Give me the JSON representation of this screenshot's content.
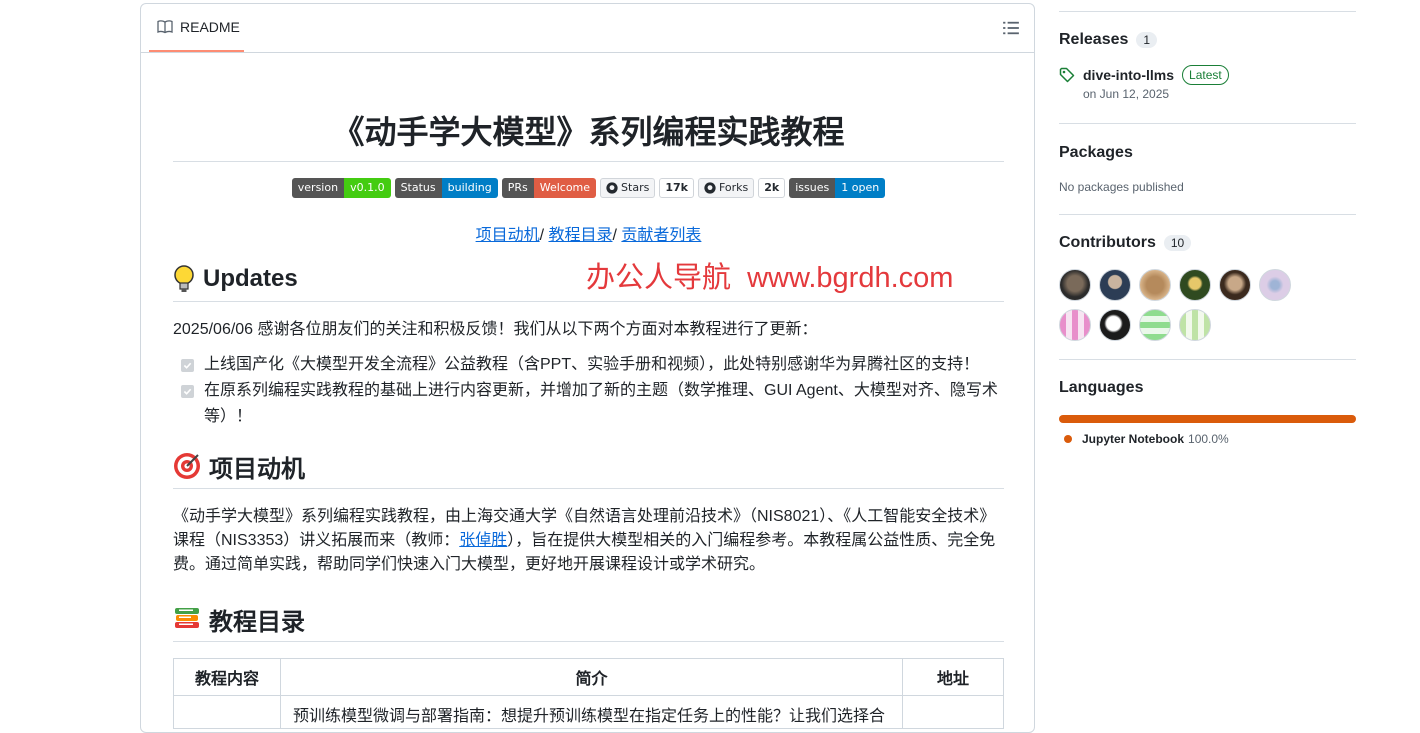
{
  "readme": {
    "tab_label": "README",
    "title": "《动手学大模型》系列编程实践教程",
    "badges": [
      {
        "left": "version",
        "right": "v0.1.0",
        "color": "#4c1"
      },
      {
        "left": "Status",
        "right": "building",
        "color": "#007ec6"
      },
      {
        "left": "PRs",
        "right": "Welcome",
        "color": "#e05d44"
      }
    ],
    "social": [
      {
        "left": "Stars",
        "right": "17k"
      },
      {
        "left": "Forks",
        "right": "2k"
      }
    ],
    "issues_badge": {
      "left": "issues",
      "right": "1 open",
      "color": "#007ec6"
    },
    "nav_links": [
      "项目动机",
      "教程目录",
      "贡献者列表"
    ],
    "nav_sep": "/ ",
    "updates": {
      "heading": "Updates",
      "intro": "2025/06/06 感谢各位朋友们的关注和积极反馈！我们从以下两个方面对本教程进行了更新：",
      "tasks": [
        "上线国产化《大模型开发全流程》公益教程（含PPT、实验手册和视频），此处特别感谢华为昇腾社区的支持！",
        "在原系列编程实践教程的基础上进行内容更新，并增加了新的主题（数学推理、GUI Agent、大模型对齐、隐写术等）！"
      ]
    },
    "motivation": {
      "heading": "项目动机",
      "text_before": "《动手学大模型》系列编程实践教程，由上海交通大学《自然语言处理前沿技术》（NIS8021）、《人工智能安全技术》课程（NIS3353）讲义拓展而来（教师：",
      "teacher_link": "张倬胜",
      "text_after": "），旨在提供大模型相关的入门编程参考。本教程属公益性质、完全免费。通过简单实践，帮助同学们快速入门大模型，更好地开展课程设计或学术研究。"
    },
    "toc": {
      "heading": "教程目录",
      "columns": [
        "教程内容",
        "简介",
        "地址"
      ],
      "first_row_partial": "预训练模型微调与部署指南：想提升预训练模型在指定任务上的性能？让我们选择合"
    }
  },
  "watermark": "办公人导航  www.bgrdh.com",
  "sidebar": {
    "releases": {
      "heading": "Releases",
      "count": "1",
      "tag_name": "dive-into-llms",
      "latest_label": "Latest",
      "date": "on Jun 12, 2025"
    },
    "packages": {
      "heading": "Packages",
      "text": "No packages published"
    },
    "contributors": {
      "heading": "Contributors",
      "count": "10",
      "avatars": [
        "avatar-1",
        "avatar-2",
        "avatar-3",
        "avatar-4",
        "avatar-5",
        "avatar-6",
        "avatar-7",
        "avatar-8",
        "avatar-9",
        "avatar-10"
      ]
    },
    "languages": {
      "heading": "Languages",
      "name": "Jupyter Notebook",
      "percent": "100.0%",
      "share": 1.0,
      "color": "#DA5B0B"
    }
  }
}
